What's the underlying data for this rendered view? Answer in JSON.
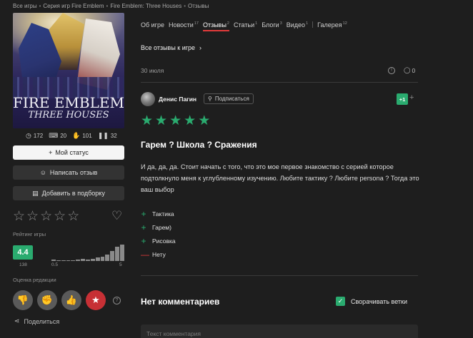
{
  "breadcrumb": [
    "Все игры",
    "Серия игр Fire Emblem",
    "Fire Emblem: Three Houses",
    "Отзывы"
  ],
  "cover": {
    "logo_line1": "FIRE EMBLEM",
    "logo_line2": "THREE HOUSES"
  },
  "stats": [
    {
      "icon": "clock-icon",
      "glyph": "◷",
      "value": "172"
    },
    {
      "icon": "gamepad-icon",
      "glyph": "🎮",
      "value": "20"
    },
    {
      "icon": "hand-icon",
      "glyph": "✋",
      "value": "101"
    },
    {
      "icon": "pause-icon",
      "glyph": "⏸",
      "value": "32"
    }
  ],
  "buttons": {
    "status": "Мой статус",
    "write_review": "Написать отзыв",
    "add_collection": "Добавить в подборку"
  },
  "rating": {
    "label": "Рейтинг игры",
    "score": "4.4",
    "count": "138",
    "histogram_min": "0.5",
    "histogram_max": "5",
    "histogram": [
      2,
      1,
      1,
      1,
      1,
      2,
      3,
      2,
      3,
      5,
      6,
      9,
      14,
      20,
      23
    ]
  },
  "editor": {
    "label": "Оценка редакции"
  },
  "share_label": "Поделиться",
  "tabs": [
    {
      "label": "Об игре",
      "count": ""
    },
    {
      "label": "Новости",
      "count": "17"
    },
    {
      "label": "Отзывы",
      "count": "2",
      "active": true
    },
    {
      "label": "Статьи",
      "count": "1"
    },
    {
      "label": "Блоги",
      "count": "3"
    },
    {
      "label": "Видео",
      "count": "1"
    },
    {
      "label": "Галерея",
      "count": "12"
    }
  ],
  "all_reviews": "Все отзывы к игре",
  "review": {
    "date": "30 июля",
    "comments_count": "0",
    "author": "Денис Пагин",
    "subscribe": "Подписаться",
    "likes": "+1",
    "stars": 5,
    "title": "Гарем ? Школа ? Сражения",
    "body": "И да, да, да. Стоит начать с того, что это мое первое знакомство с серией которое подтолкнуло меня к углубленному изучению. Любите тактику ? Любите persona ? Тогда это ваш выбор",
    "pros": [
      "Тактика",
      "Гарем)",
      "Рисовка"
    ],
    "cons": [
      "Нету"
    ]
  },
  "comments": {
    "title": "Нет комментариев",
    "collapse_label": "Сворачивать ветки",
    "placeholder": "Текст комментария"
  }
}
